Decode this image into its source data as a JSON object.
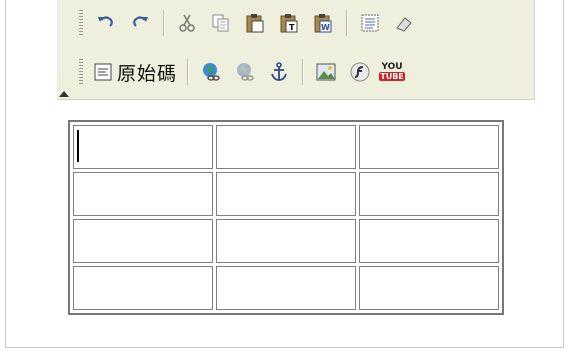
{
  "toolbar": {
    "row1": {
      "buttons": [
        "undo-icon",
        "redo-icon",
        "cut-icon",
        "copy-icon",
        "paste-icon",
        "paste-text-icon",
        "paste-word-icon",
        "select-all-icon",
        "eraser-icon"
      ]
    },
    "row2": {
      "source_label": "原始碼",
      "buttons": [
        "link-icon",
        "unlink-icon",
        "anchor-icon",
        "image-icon",
        "flash-icon"
      ],
      "youtube": {
        "top": "YOU",
        "bottom": "TUBE"
      }
    }
  },
  "table": {
    "rows": 4,
    "cols": 3,
    "cells": [
      [
        "",
        "",
        ""
      ],
      [
        "",
        "",
        ""
      ],
      [
        "",
        "",
        ""
      ],
      [
        "",
        "",
        ""
      ]
    ]
  }
}
